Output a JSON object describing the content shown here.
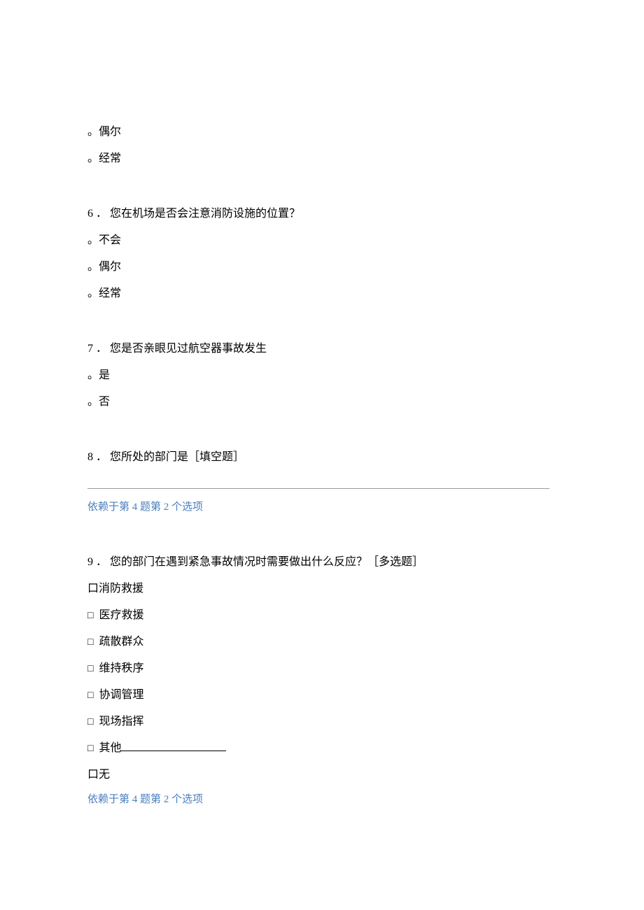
{
  "q5_trailing": {
    "options": [
      "偶尔",
      "经常"
    ]
  },
  "q6": {
    "number": "6",
    "sep": "．",
    "text": "您在机场是否会注意消防设施的位置？",
    "options": [
      "不会",
      "偶尔",
      "经常"
    ]
  },
  "q7": {
    "number": "7",
    "sep": "．",
    "text": "您是否亲眼见过航空器事故发生",
    "options": [
      "是",
      "否"
    ]
  },
  "q8": {
    "number": "8",
    "sep": "．",
    "text": "您所处的部门是［填空题］",
    "dependency": "依赖于第 4 题第 2 个选项"
  },
  "q9": {
    "number": "9",
    "sep": "．",
    "text": "您的部门在遇到紧急事故情况时需要做出什么反应？［多选题］",
    "options_literal_first": "口消防救援",
    "options": [
      "医疗救援",
      "疏散群众",
      "维持秩序",
      "协调管理",
      "现场指挥"
    ],
    "other_label": "其他",
    "options_literal_last": "口无",
    "dependency": "依赖于第 4 题第 2 个选项"
  },
  "glyphs": {
    "radio": "。",
    "checkbox": "□"
  }
}
